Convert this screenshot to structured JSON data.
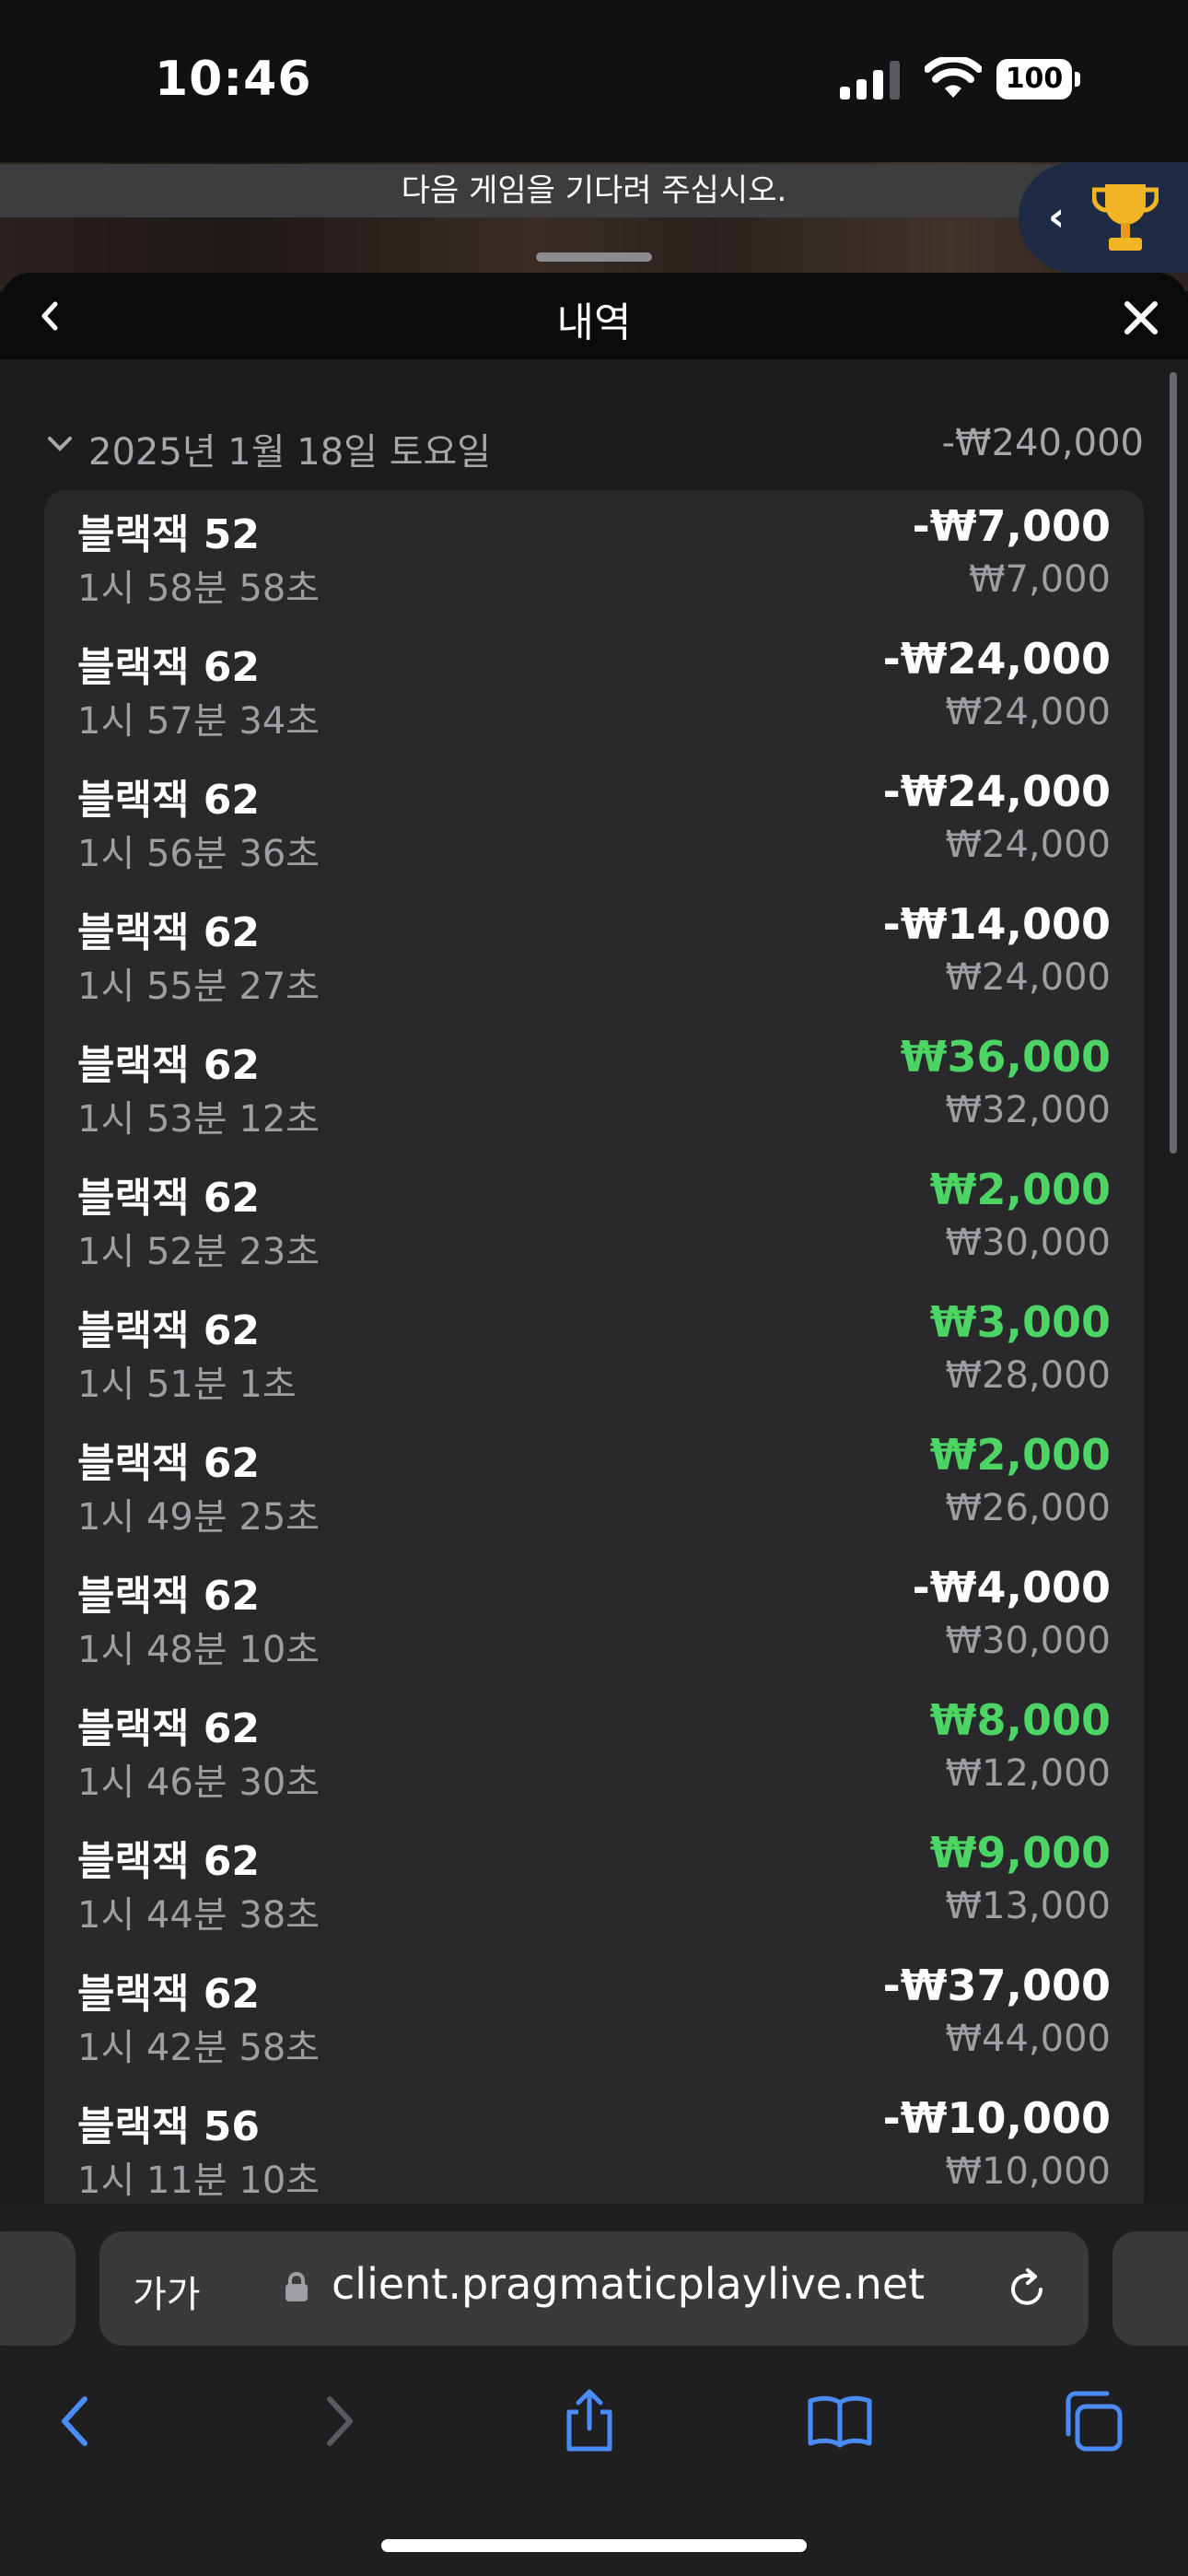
{
  "status": {
    "time": "10:46",
    "battery": "100"
  },
  "banner": {
    "text": "다음 게임을 기다려 주십시오."
  },
  "sheet": {
    "title": "내역"
  },
  "day": {
    "date": "2025년 1월 18일 토요일",
    "total": "-₩240,000"
  },
  "rows": [
    {
      "game": "블랙잭 52",
      "time": "1시 58분 58초",
      "amount": "-₩7,000",
      "bet": "₩7,000",
      "positive": false
    },
    {
      "game": "블랙잭 62",
      "time": "1시 57분 34초",
      "amount": "-₩24,000",
      "bet": "₩24,000",
      "positive": false
    },
    {
      "game": "블랙잭 62",
      "time": "1시 56분 36초",
      "amount": "-₩24,000",
      "bet": "₩24,000",
      "positive": false
    },
    {
      "game": "블랙잭 62",
      "time": "1시 55분 27초",
      "amount": "-₩14,000",
      "bet": "₩24,000",
      "positive": false
    },
    {
      "game": "블랙잭 62",
      "time": "1시 53분 12초",
      "amount": "₩36,000",
      "bet": "₩32,000",
      "positive": true
    },
    {
      "game": "블랙잭 62",
      "time": "1시 52분 23초",
      "amount": "₩2,000",
      "bet": "₩30,000",
      "positive": true
    },
    {
      "game": "블랙잭 62",
      "time": "1시 51분 1초",
      "amount": "₩3,000",
      "bet": "₩28,000",
      "positive": true
    },
    {
      "game": "블랙잭 62",
      "time": "1시 49분 25초",
      "amount": "₩2,000",
      "bet": "₩26,000",
      "positive": true
    },
    {
      "game": "블랙잭 62",
      "time": "1시 48분 10초",
      "amount": "-₩4,000",
      "bet": "₩30,000",
      "positive": false
    },
    {
      "game": "블랙잭 62",
      "time": "1시 46분 30초",
      "amount": "₩8,000",
      "bet": "₩12,000",
      "positive": true
    },
    {
      "game": "블랙잭 62",
      "time": "1시 44분 38초",
      "amount": "₩9,000",
      "bet": "₩13,000",
      "positive": true
    },
    {
      "game": "블랙잭 62",
      "time": "1시 42분 58초",
      "amount": "-₩37,000",
      "bet": "₩44,000",
      "positive": false
    },
    {
      "game": "블랙잭 56",
      "time": "1시 11분 10초",
      "amount": "-₩10,000",
      "bet": "₩10,000",
      "positive": false
    }
  ],
  "browser": {
    "text_size": "가가",
    "url": "client.pragmaticplaylive.net"
  },
  "colors": {
    "positive": "#4cd465",
    "negative": "#ffffff",
    "sheet": "#1c1c1e",
    "accent_blue": "#4a8cf7"
  },
  "icons": [
    "signal-icon",
    "wifi-icon",
    "battery-icon",
    "chevron-left-icon",
    "trophy-icon",
    "close-icon",
    "chevron-down-icon",
    "lock-icon",
    "reload-icon",
    "back-icon",
    "forward-icon",
    "share-icon",
    "bookmarks-icon",
    "tabs-icon"
  ]
}
